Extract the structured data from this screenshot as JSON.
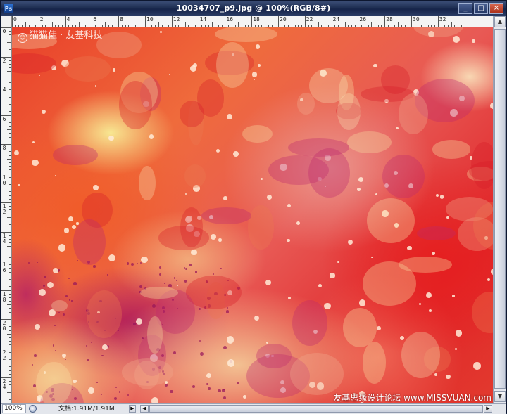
{
  "window": {
    "title": "10034707_p9.jpg @ 100%(RGB/8#)",
    "app_icon_label": "Ps",
    "buttons": [
      "minimize",
      "maximize",
      "close"
    ]
  },
  "rulers": {
    "horizontal_labels": [
      "0",
      "2",
      "4",
      "6",
      "8",
      "10",
      "12",
      "14",
      "16",
      "18",
      "20",
      "22",
      "24",
      "26",
      "28",
      "30",
      "32"
    ],
    "vertical_labels": [
      "0",
      "2",
      "4",
      "6",
      "8",
      "10",
      "12",
      "14",
      "16",
      "18",
      "20",
      "22",
      "24"
    ]
  },
  "canvas": {
    "watermark_top_left": "猫猫佳 · 友基科技",
    "watermark_bottom_right": "友基思缘设计论坛 www.MISSVUAN.com",
    "colors": {
      "red": "#e0262a",
      "orange": "#ef6b3c",
      "yellow": "#f8ee96",
      "magenta": "#aa145a"
    }
  },
  "statusbar": {
    "zoom": "100%",
    "doc_info": "文档:1.91M/1.91M",
    "arrow_icon": "triangle-right-icon"
  },
  "scrollbars": {
    "up_arrow": "▲",
    "down_arrow": "▼",
    "left_arrow": "◀",
    "right_arrow": "▶",
    "status_arrow": "▶"
  }
}
